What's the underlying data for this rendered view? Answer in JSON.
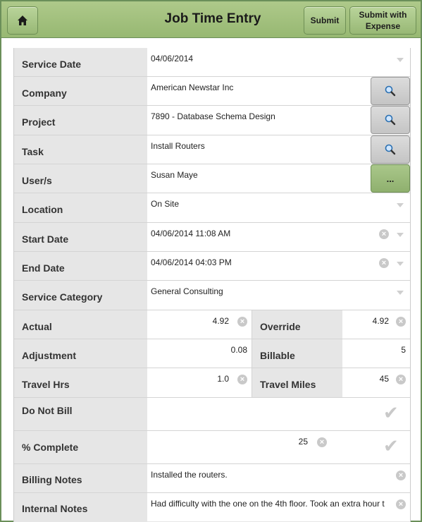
{
  "header": {
    "title": "Job Time Entry",
    "submit_label": "Submit",
    "submit_expense_label": "Submit with Expense"
  },
  "form": {
    "service_date": {
      "label": "Service Date",
      "value": "04/06/2014"
    },
    "company": {
      "label": "Company",
      "value": "American Newstar Inc"
    },
    "project": {
      "label": "Project",
      "value": "7890 - Database Schema Design"
    },
    "task": {
      "label": "Task",
      "value": "Install Routers"
    },
    "users": {
      "label": "User/s",
      "value": "Susan Maye",
      "button": "..."
    },
    "location": {
      "label": "Location",
      "value": "On Site"
    },
    "start_date": {
      "label": "Start Date",
      "value": "04/06/2014 11:08 AM"
    },
    "end_date": {
      "label": "End Date",
      "value": "04/06/2014 04:03 PM"
    },
    "service_category": {
      "label": "Service Category",
      "value": "General Consulting"
    },
    "actual": {
      "label": "Actual",
      "value": "4.92"
    },
    "override": {
      "label": "Override",
      "value": "4.92"
    },
    "adjustment": {
      "label": "Adjustment",
      "value": "0.08"
    },
    "billable": {
      "label": "Billable",
      "value": "5"
    },
    "travel_hrs": {
      "label": "Travel Hrs",
      "value": "1.0"
    },
    "travel_miles": {
      "label": "Travel Miles",
      "value": "45"
    },
    "do_not_bill": {
      "label": "Do Not Bill"
    },
    "pct_complete": {
      "label": "% Complete",
      "value": "25"
    },
    "billing_notes": {
      "label": "Billing Notes",
      "value": "Installed the routers."
    },
    "internal_notes": {
      "label": "Internal Notes",
      "value": "Had difficulty with the one on the 4th floor.  Took an extra hour t"
    }
  },
  "colors": {
    "header_green": "#a3c17f",
    "border_green": "#6b8f5a",
    "field_bg": "#ffffff",
    "label_bg": "#e6e6e6"
  },
  "icons": {
    "home": "home-icon",
    "search": "magnifier-icon",
    "clear": "clear-x-icon",
    "dropdown": "chevron-down-icon",
    "check": "checkmark-icon"
  }
}
